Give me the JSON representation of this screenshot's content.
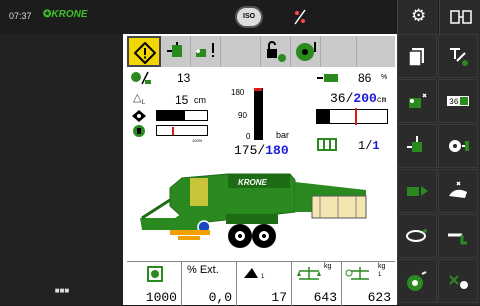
{
  "status": {
    "time": "07:37",
    "brand": "KRONE",
    "iso_label": "ISO"
  },
  "stats": {
    "row1_value": "13",
    "row2_value": "15",
    "row2_unit": "cm",
    "row1_right_value": "86",
    "row1_right_unit": "%",
    "length_value": "36",
    "length_target": "200",
    "length_unit": "cm",
    "counter_value": "1",
    "counter_target": "1"
  },
  "gauge": {
    "tick_180": "180",
    "tick_90": "90",
    "tick_0": "0",
    "unit": "bar",
    "value": "175",
    "target": "180"
  },
  "bottom": {
    "cell1_value": "1000",
    "cell2_label": "% Ext.",
    "cell2_value": "0,0",
    "cell3_sub": "1",
    "cell3_value": "17",
    "cell4_unit": "kg",
    "cell4_value": "643",
    "cell5_unit": "kg",
    "cell5_sub": "1",
    "cell5_value": "623"
  },
  "left_button_label": "■■■",
  "colors": {
    "accent_green": "#2a8a1f",
    "dark_green": "#1e6b16",
    "warning_yellow": "#f2d600",
    "blue": "#1a1ad8",
    "red": "#d81a1a"
  }
}
